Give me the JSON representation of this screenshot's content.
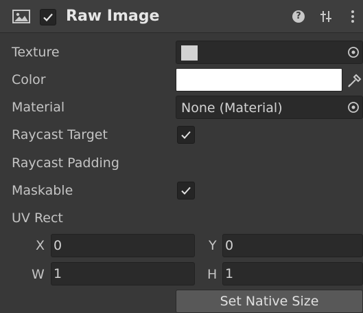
{
  "component": {
    "icon": "raw-image-icon",
    "enabled": true,
    "title": "Raw Image",
    "help_icon_glyph": "?"
  },
  "properties": {
    "texture": {
      "label": "Texture",
      "value_swatch": "#d2d2d2"
    },
    "color": {
      "label": "Color",
      "value": "#ffffff"
    },
    "material": {
      "label": "Material",
      "value": "None (Material)"
    },
    "raycast_target": {
      "label": "Raycast Target",
      "checked": true
    },
    "raycast_padding": {
      "label": "Raycast Padding"
    },
    "maskable": {
      "label": "Maskable",
      "checked": true
    },
    "uv_rect": {
      "label": "UV Rect",
      "x_label": "X",
      "x": "0",
      "y_label": "Y",
      "y": "0",
      "w_label": "W",
      "w": "1",
      "h_label": "H",
      "h": "1"
    }
  },
  "buttons": {
    "set_native_size": "Set Native Size"
  },
  "colors": {
    "background": "#383838",
    "header": "#3e3e3e",
    "field": "#2a2a2a",
    "button": "#585858"
  }
}
